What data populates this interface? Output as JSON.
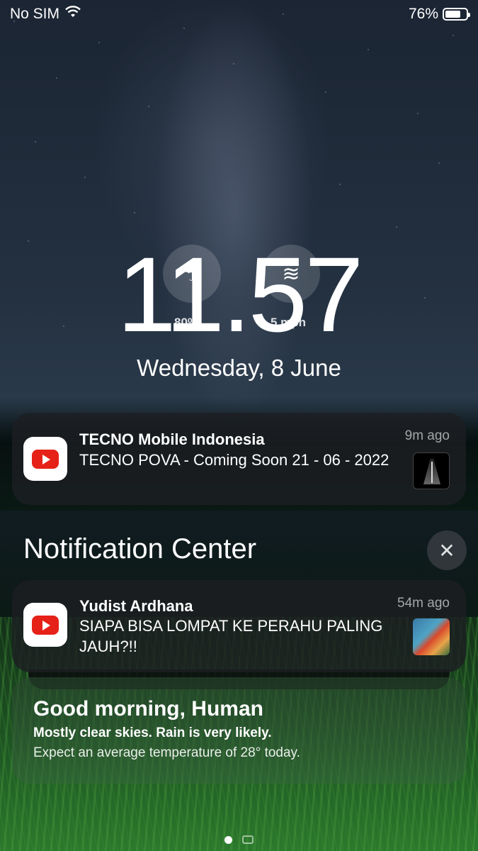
{
  "status_bar": {
    "carrier": "No SIM",
    "battery_percent": "76%",
    "battery_level": 0.76
  },
  "lock_screen": {
    "time": "11.57",
    "date": "Wednesday, 8 June",
    "weather_widgets": {
      "humidity_value": "80%",
      "humidity_icon": "umbrella-icon",
      "wind_value": "5 mph",
      "wind_icon": "wind-icon"
    }
  },
  "notifications": [
    {
      "app_icon": "youtube-icon",
      "title": "TECNO Mobile Indonesia",
      "body": "TECNO POVA - Coming Soon 21 - 06 - 2022",
      "time": "9m ago"
    },
    {
      "app_icon": "youtube-icon",
      "title": "Yudist Ardhana",
      "body": "SIAPA BISA LOMPAT KE PERAHU PALING JAUH?!!",
      "time": "54m ago"
    }
  ],
  "notification_center": {
    "title": "Notification Center",
    "close_icon": "close-icon"
  },
  "weather_card": {
    "greeting": "Good morning, Human",
    "summary": "Mostly clear skies. Rain is very likely.",
    "detail": "Expect an average temperature of 28° today."
  },
  "colors": {
    "youtube_red": "#e62117",
    "card_background": "#1c1e22"
  }
}
